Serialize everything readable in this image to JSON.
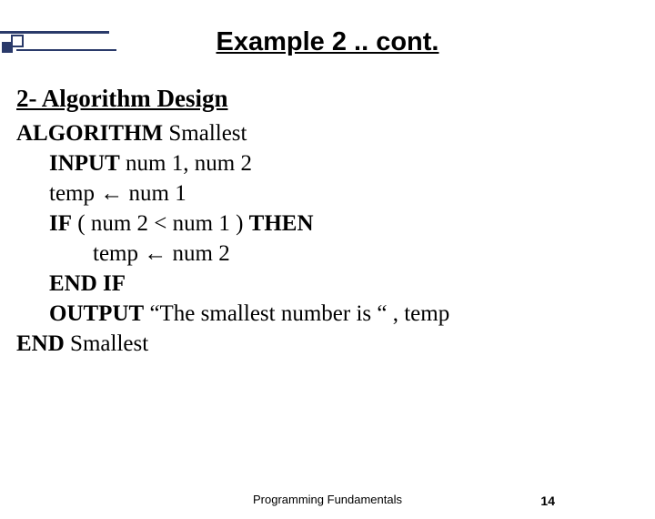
{
  "title": "Example 2 .. cont.",
  "section_heading": "2- Algorithm Design",
  "algo": {
    "l1": {
      "kw": "ALGORITHM",
      "rest": " Smallest"
    },
    "l2": {
      "kw": "INPUT",
      "rest": " num 1, num 2"
    },
    "l3": {
      "a": "temp ",
      "arrow": "←",
      "b": " num 1"
    },
    "l4": {
      "kw1": "IF",
      "mid": " ( num 2 < num 1 ) ",
      "kw2": "THEN"
    },
    "l5": {
      "a": "temp ",
      "arrow": "←",
      "b": " num 2"
    },
    "l6": {
      "kw": "END IF"
    },
    "l7": {
      "kw": "OUTPUT",
      "rest": " “The smallest number is “ , temp"
    },
    "l8": {
      "kw": "END",
      "rest": " Smallest"
    }
  },
  "footer": "Programming Fundamentals",
  "page_number": "14"
}
